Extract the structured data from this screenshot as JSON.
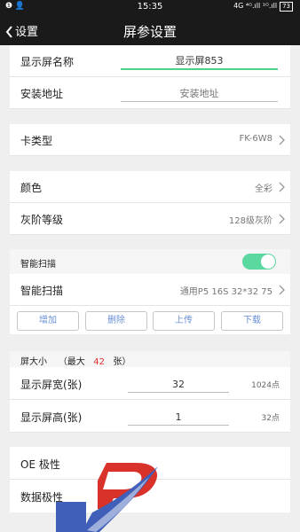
{
  "statusbar": {
    "left_icons": "❶ 👤",
    "time": "15:35",
    "signal": "4G ⁴ᴳ.ıll ¹ᴳ.ıll",
    "battery": "73"
  },
  "header": {
    "back_label": "设置",
    "title": "屏参设置"
  },
  "display_name": {
    "label": "显示屏名称",
    "value": "显示屏853"
  },
  "install_addr": {
    "label": "安装地址",
    "placeholder": "安装地址"
  },
  "card_type": {
    "label": "卡类型",
    "value": "FK-6W8"
  },
  "color": {
    "label": "颜色",
    "value": "全彩"
  },
  "gray_level": {
    "label": "灰阶等级",
    "value": "128级灰阶"
  },
  "smart_scan_section": {
    "label": "智能扫描",
    "toggle_on": true
  },
  "smart_scan": {
    "label": "智能扫描",
    "value": "通用P5 16S 32*32 75"
  },
  "actions": {
    "add": "增加",
    "delete": "删除",
    "upload": "上传",
    "download": "下载"
  },
  "screen_size": {
    "label": "屏大小",
    "max_prefix": "（最大",
    "max_value": "42",
    "max_suffix": "张）"
  },
  "screen_width": {
    "label": "显示屏宽(张)",
    "value": "32",
    "unit": "1024点"
  },
  "screen_height": {
    "label": "显示屏高(张)",
    "value": "1",
    "unit": "32点"
  },
  "oe_polarity": {
    "label": "OE 极性"
  },
  "data_polarity": {
    "label": "数据极性"
  },
  "colors": {
    "accent_green": "#5bd7a0",
    "header_bg": "#1a1a1a",
    "link_blue": "#6a90d6",
    "max_red": "#e0322d"
  }
}
